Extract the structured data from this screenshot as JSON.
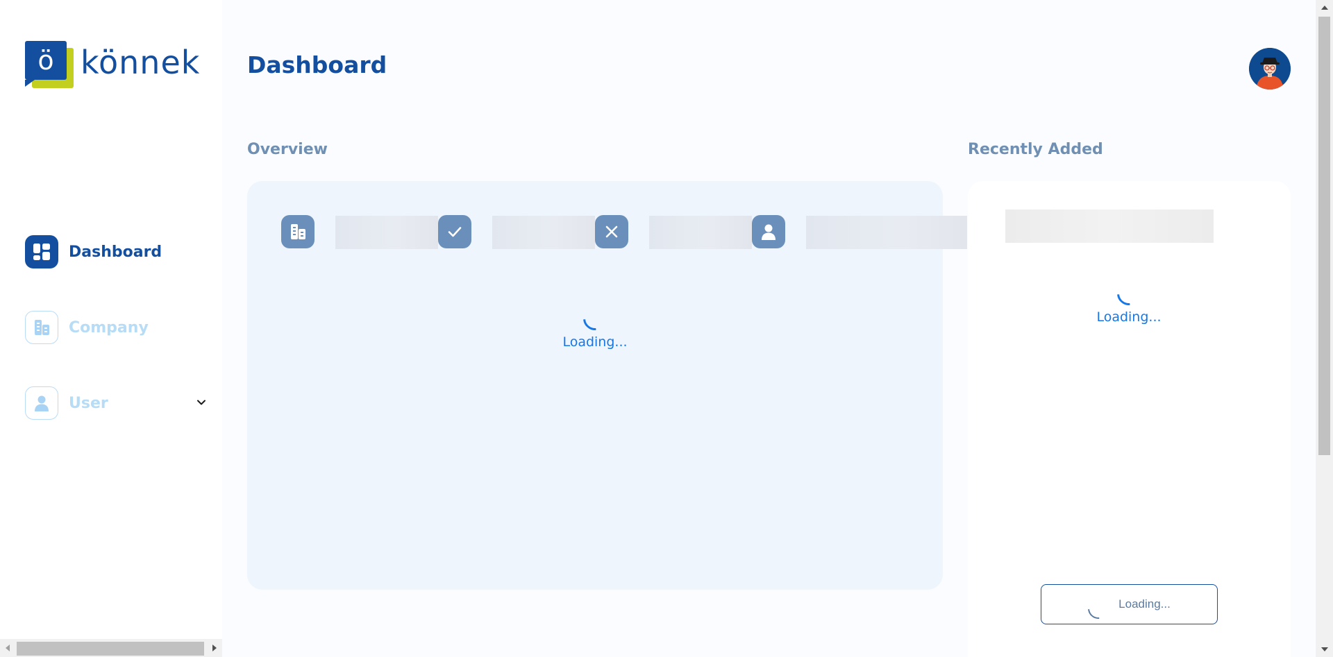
{
  "brand": {
    "mark_letter": "ö",
    "name": "könnek",
    "primary_color": "#134f9e",
    "accent_color": "#c2cf1e"
  },
  "sidebar": {
    "items": [
      {
        "label": "Dashboard",
        "icon": "dashboard-grid-icon",
        "active": true
      },
      {
        "label": "Company",
        "icon": "company-building-icon",
        "active": false
      },
      {
        "label": "User",
        "icon": "user-icon",
        "active": false,
        "expandable": true
      }
    ]
  },
  "header": {
    "title": "Dashboard",
    "avatar": "user-avatar"
  },
  "overview": {
    "title": "Overview",
    "stat_icons": [
      "company-building-icon",
      "check-icon",
      "close-icon",
      "user-icon"
    ],
    "loading_text": "Loading..."
  },
  "recent": {
    "title": "Recently Added",
    "loading_text": "Loading...",
    "button_loading_text": "Loading..."
  },
  "colors": {
    "loading": "#1677e6",
    "section_title": "#6f8fb3",
    "inactive_nav": "#b7dcf6"
  }
}
